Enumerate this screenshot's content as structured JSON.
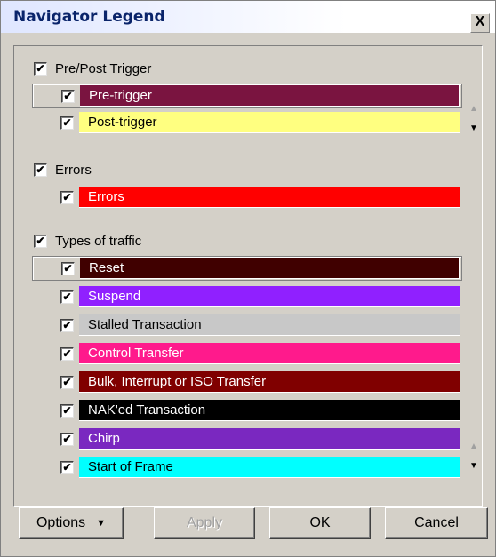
{
  "window": {
    "title": "Navigator Legend",
    "close_label": "X"
  },
  "groups": [
    {
      "label": "Pre/Post Trigger",
      "checked": true,
      "items": [
        {
          "label": "Pre-trigger",
          "color": "#7a1440",
          "text_color": "#ffffff",
          "checked": true,
          "selected": true
        },
        {
          "label": "Post-trigger",
          "color": "#ffff80",
          "text_color": "#000000",
          "checked": true
        }
      ]
    },
    {
      "label": "Errors",
      "checked": true,
      "items": [
        {
          "label": "Errors",
          "color": "#ff0000",
          "text_color": "#ffffff",
          "checked": true
        }
      ]
    },
    {
      "label": "Types of traffic",
      "checked": true,
      "items": [
        {
          "label": "Reset",
          "color": "#400000",
          "text_color": "#ffffff",
          "checked": true,
          "selected": true
        },
        {
          "label": "Suspend",
          "color": "#9020ff",
          "text_color": "#ffffff",
          "checked": true
        },
        {
          "label": "Stalled Transaction",
          "color": "#c8c8c8",
          "text_color": "#000000",
          "checked": true
        },
        {
          "label": "Control Transfer",
          "color": "#ff1a8c",
          "text_color": "#ffffff",
          "checked": true
        },
        {
          "label": "Bulk, Interrupt or ISO Transfer",
          "color": "#800000",
          "text_color": "#ffffff",
          "checked": true
        },
        {
          "label": "NAK'ed Transaction",
          "color": "#000000",
          "text_color": "#ffffff",
          "checked": true
        },
        {
          "label": "Chirp",
          "color": "#7a28c0",
          "text_color": "#ffffff",
          "checked": true
        },
        {
          "label": "Start of Frame",
          "color": "#00ffff",
          "text_color": "#000000",
          "checked": true
        }
      ]
    }
  ],
  "buttons": {
    "options": "Options",
    "apply": "Apply",
    "ok": "OK",
    "cancel": "Cancel"
  }
}
